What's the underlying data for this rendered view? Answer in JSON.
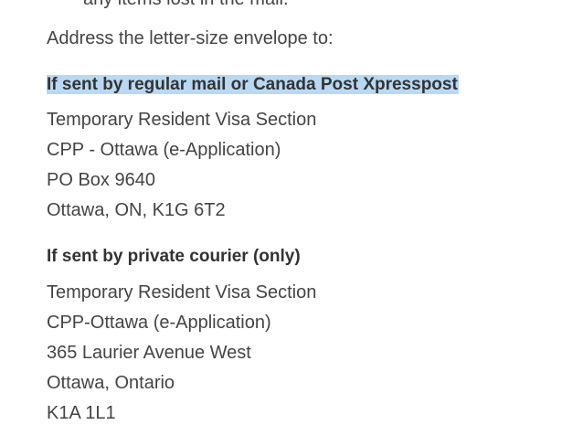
{
  "previous_line_fragment": "any items lost in the mail.",
  "intro": "Address the letter-size envelope to:",
  "regular_mail": {
    "heading": "If sent by regular mail or Canada Post Xpresspost",
    "lines": [
      "Temporary Resident Visa Section",
      "CPP - Ottawa (e-Application)",
      "PO Box 9640",
      "Ottawa, ON, K1G 6T2"
    ]
  },
  "courier": {
    "heading": "If sent by private courier (only)",
    "lines": [
      "Temporary Resident Visa Section",
      "CPP-Ottawa (e-Application)",
      "365 Laurier Avenue West",
      "Ottawa, Ontario",
      "K1A 1L1"
    ]
  },
  "colors": {
    "text": "#444444",
    "selection_highlight": "#b9d8f3"
  }
}
